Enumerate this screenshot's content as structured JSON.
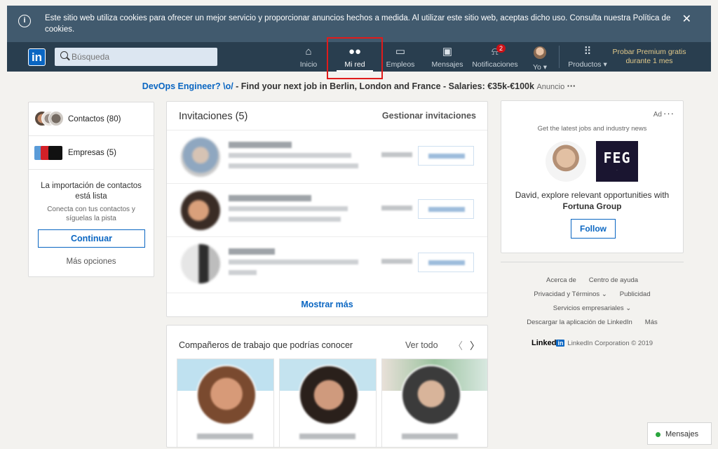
{
  "cookie_banner": {
    "text": "Este sitio web utiliza cookies para ofrecer un mejor servicio y proporcionar anuncios hechos a medida. Al utilizar este sitio web, aceptas dicho uso. Consulta nuestra Política de cookies.",
    "info_icon": "info-icon",
    "close_symbol": "✕"
  },
  "nav": {
    "logo_text": "in",
    "search_placeholder": "Búsqueda",
    "items": [
      {
        "label": "Inicio",
        "icon": "home-icon",
        "glyph": "⌂"
      },
      {
        "label": "Mi red",
        "icon": "people-icon",
        "glyph": "👥",
        "active": true
      },
      {
        "label": "Empleos",
        "icon": "briefcase-icon",
        "glyph": "▭"
      },
      {
        "label": "Mensajes",
        "icon": "messages-icon",
        "glyph": "▣"
      },
      {
        "label": "Notificaciones",
        "icon": "bell-icon",
        "glyph": "⍾",
        "badge": "2"
      },
      {
        "label": "Yo ▾",
        "icon": "avatar"
      },
      {
        "label": "Productos ▾",
        "icon": "grid-icon",
        "glyph": "⠿"
      }
    ],
    "premium": "Probar Premium gratis durante 1 mes"
  },
  "ad_line": {
    "link": "DevOps Engineer? \\o/",
    "text": " - Find your next job in Berlin, London and France - Salaries: €35k-€100k",
    "tag": "Anuncio",
    "dots": "···"
  },
  "left": {
    "contacts": "Contactos (80)",
    "companies": "Empresas (5)",
    "import_title": "La importación de contactos está lista",
    "import_sub": "Conecta con tus contactos y síguelas la pista",
    "continue": "Continuar",
    "more": "Más opciones"
  },
  "invitations": {
    "title": "Invitaciones (5)",
    "manage": "Gestionar invitaciones",
    "show_more": "Mostrar más"
  },
  "coworkers": {
    "title": "Compañeros de trabajo que podrías conocer",
    "see_all": "Ver todo",
    "prev": "〈",
    "next": "〉"
  },
  "ad_card": {
    "tag": "Ad",
    "dots": "···",
    "subtitle": "Get the latest jobs and industry news",
    "logo": "FEG",
    "message_prefix": "David, explore relevant opportunities with ",
    "company": "Fortuna Group",
    "follow": "Follow"
  },
  "footer": {
    "row1": [
      "Acerca de",
      "Centro de ayuda"
    ],
    "row2": [
      "Privacidad y Términos ⌄",
      "Publicidad"
    ],
    "row3": [
      "Servicios empresariales ⌄"
    ],
    "row4": [
      "Descargar la aplicación de LinkedIn",
      "Más"
    ],
    "brand_word": "Linked",
    "brand_in": "in",
    "copyright": "LinkedIn Corporation © 2019"
  },
  "messaging_tab": "Mensajes",
  "colors": {
    "accent": "#0a66c2",
    "nav_bg": "#293e4f",
    "banner_bg": "#415a6e",
    "highlight": "#e01b1b"
  }
}
